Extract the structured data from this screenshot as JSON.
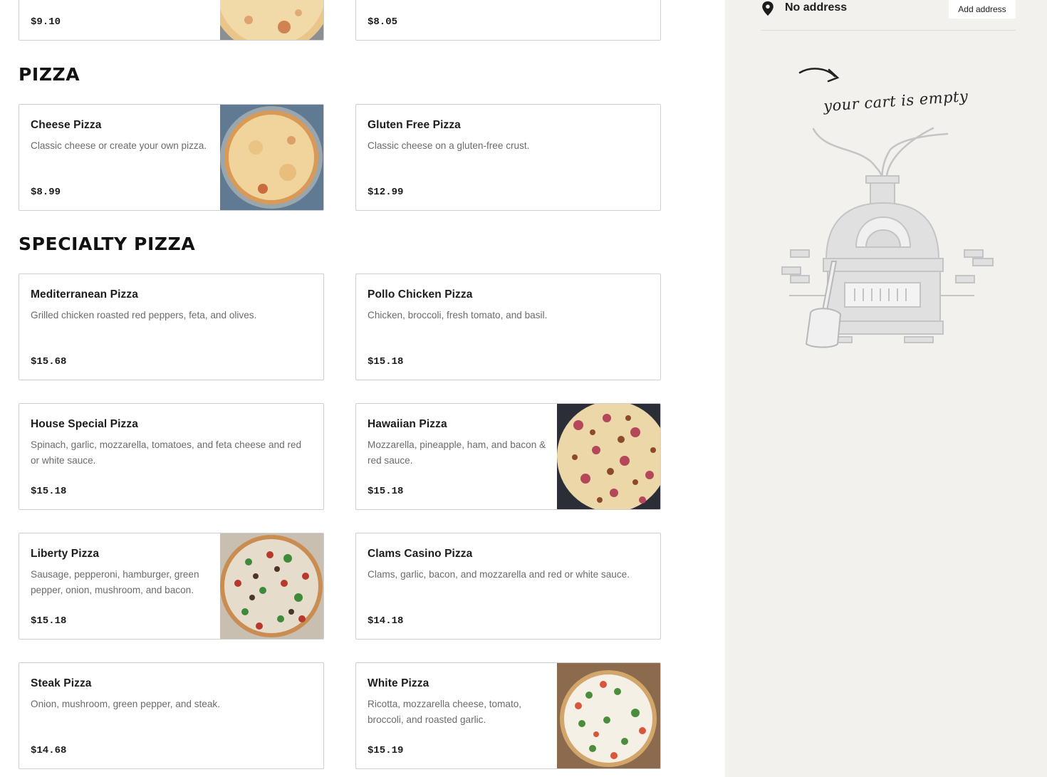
{
  "sections": {
    "pizza_title": "PIZZA",
    "specialty_title": "SPECIALTY PIZZA"
  },
  "top_items": [
    {
      "price": "$9.10"
    },
    {
      "price": "$8.05"
    }
  ],
  "pizza_items": [
    {
      "name": "Cheese Pizza",
      "desc": "Classic cheese or create your own pizza.",
      "price": "$8.99"
    },
    {
      "name": "Gluten Free Pizza",
      "desc": "Classic cheese on a gluten-free crust.",
      "price": "$12.99"
    }
  ],
  "specialty_items": [
    {
      "name": "Mediterranean Pizza",
      "desc": "Grilled chicken roasted red peppers, feta, and olives.",
      "price": "$15.68"
    },
    {
      "name": "Pollo Chicken Pizza",
      "desc": "Chicken, broccoli, fresh tomato, and basil.",
      "price": "$15.18"
    },
    {
      "name": "House Special Pizza",
      "desc": "Spinach, garlic, mozzarella, tomatoes, and feta cheese and red or white sauce.",
      "price": "$15.18"
    },
    {
      "name": "Hawaiian Pizza",
      "desc": "Mozzarella, pineapple, ham, and bacon & red sauce.",
      "price": "$15.18"
    },
    {
      "name": "Liberty Pizza",
      "desc": "Sausage, pepperoni, hamburger, green pepper, onion, mushroom, and bacon.",
      "price": "$15.18"
    },
    {
      "name": "Clams Casino Pizza",
      "desc": "Clams, garlic, bacon, and mozzarella and red or white sauce.",
      "price": "$14.18"
    },
    {
      "name": "Steak Pizza",
      "desc": "Onion, mushroom, green pepper, and steak.",
      "price": "$14.68"
    },
    {
      "name": "White Pizza",
      "desc": "Ricotta, mozzarella cheese, tomato, broccoli, and roasted garlic.",
      "price": "$15.19"
    }
  ],
  "cart": {
    "address_text": "No address",
    "add_address_label": "Add address",
    "empty_text": "your cart is empty",
    "icon": "map-pin-icon"
  },
  "colors": {
    "panel_bg": "#f2f1ee",
    "card_border": "#cfcfcf",
    "desc_text": "#6b6b6b"
  }
}
